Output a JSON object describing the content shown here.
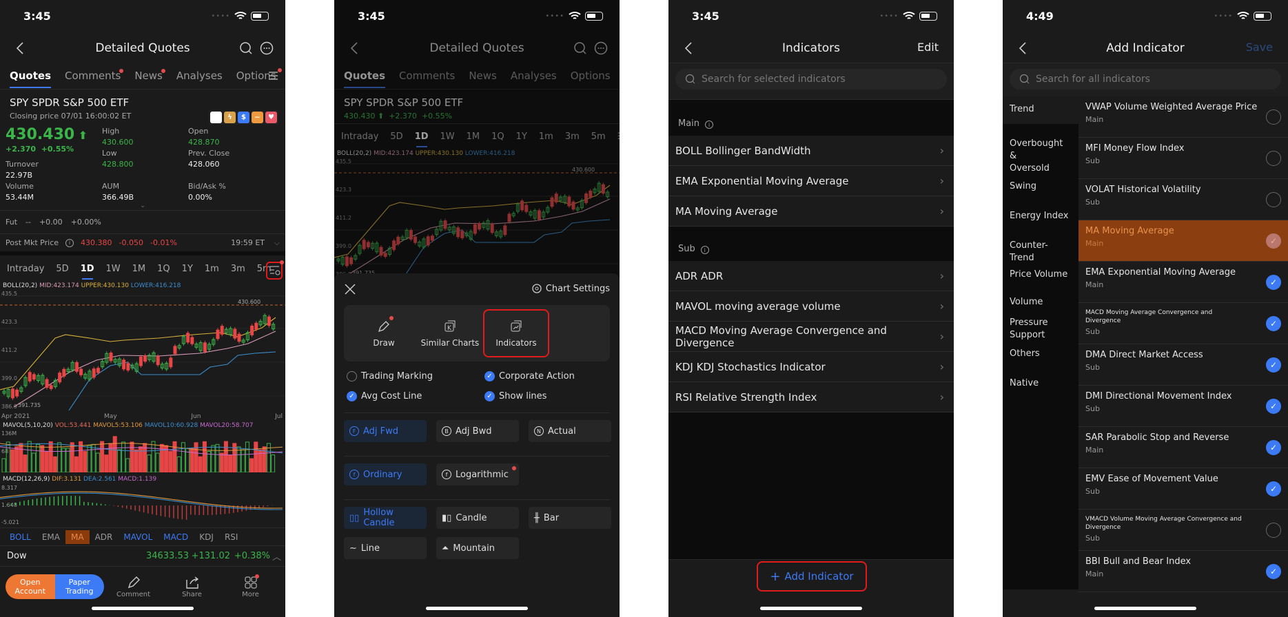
{
  "screen1": {
    "status_time": "3:45",
    "title": "Detailed Quotes",
    "tabs": [
      {
        "label": "Quotes",
        "active": true,
        "dot": false
      },
      {
        "label": "Comments",
        "active": false,
        "dot": true
      },
      {
        "label": "News",
        "active": false,
        "dot": true
      },
      {
        "label": "Analyses",
        "active": false,
        "dot": false
      },
      {
        "label": "Options",
        "active": false,
        "dot": false
      }
    ],
    "symbol_line": "SPY  SPDR S&P 500 ETF",
    "closing": "Closing price 07/01 16:00:02 ET",
    "price": "430.430",
    "change": "+2.370",
    "change_pct": "+0.55%",
    "stats": {
      "high_label": "High",
      "high": "430.600",
      "open_label": "Open",
      "open": "428.870",
      "turnover_label": "Turnover",
      "turnover": "22.97B",
      "low_label": "Low",
      "low": "428.800",
      "prev_close_label": "Prev. Close",
      "prev_close": "428.060",
      "volume_label": "Volume",
      "volume": "53.44M",
      "aum_label": "AUM",
      "aum": "366.49B",
      "bidask_label": "Bid/Ask %",
      "bidask": "0.00%"
    },
    "fut": {
      "label": "Fut",
      "value": "--",
      "change": "+0.00",
      "pct": "+0.00%"
    },
    "post": {
      "label": "Post Mkt Price",
      "price": "430.380",
      "change": "-0.050",
      "pct": "-0.01%",
      "time": "19:59 ET"
    },
    "periods": [
      "Intraday",
      "5D",
      "1D",
      "1W",
      "1M",
      "1Q",
      "1Y",
      "1m",
      "3m",
      "5m"
    ],
    "active_period": "1D",
    "boll_legend": {
      "name": "BOLL(20,2)",
      "mid": "MID:423.174",
      "upper": "UPPER:430.130",
      "lower": "LOWER:416.218"
    },
    "price_axis": [
      "435.5",
      "423.3",
      "411.2",
      "399.0",
      "386.9"
    ],
    "high_marker": "430.600",
    "low_marker": "391.735",
    "date_axis": [
      "Apr 2021",
      "May",
      "Jun",
      "Jul"
    ],
    "mavol_legend": {
      "name": "MAVOL(5,10,20)",
      "vol": "VOL:53.441",
      "m5": "MAVOL5:53.106",
      "m10": "MAVOL10:60.928",
      "m20": "MAVOL20:58.707"
    },
    "vol_axis": [
      "136M",
      "68"
    ],
    "macd_legend": {
      "name": "MACD(12,26,9)",
      "dif": "DIF:3.131",
      "dea": "DEA:2.561",
      "macd": "MACD:1.139"
    },
    "macd_axis": [
      "8.317",
      "1.648",
      "-5.021"
    ],
    "indicator_tabs": [
      {
        "label": "BOLL",
        "state": "on"
      },
      {
        "label": "EMA",
        "state": "off"
      },
      {
        "label": "MA",
        "state": "hl"
      },
      {
        "label": "ADR",
        "state": "off"
      },
      {
        "label": "MAVOL",
        "state": "on"
      },
      {
        "label": "MACD",
        "state": "on"
      },
      {
        "label": "KDJ",
        "state": "off"
      },
      {
        "label": "RSI",
        "state": "off"
      }
    ],
    "index": {
      "name": "Dow",
      "value": "34633.53",
      "change": "+131.02",
      "pct": "+0.38%"
    },
    "footer": {
      "open_account": "Open Account",
      "paper_trading": "Paper Trading",
      "comment": "Comment",
      "share": "Share",
      "more": "More"
    }
  },
  "screen2": {
    "status_time": "3:45",
    "title": "Detailed Quotes",
    "symbol_line": "SPY  SPDR S&P 500 ETF",
    "price_line": {
      "price": "430.430",
      "change": "+2.370",
      "pct": "+0.55%"
    },
    "chart_settings": "Chart Settings",
    "tools": [
      {
        "label": "Draw",
        "icon": "pencil-icon",
        "selected": false,
        "dot": true
      },
      {
        "label": "Similar Charts",
        "icon": "similar-charts-icon",
        "selected": false,
        "dot": false
      },
      {
        "label": "Indicators",
        "icon": "indicators-icon",
        "selected": true,
        "dot": false
      }
    ],
    "options": [
      {
        "label": "Trading Marking",
        "checked": false
      },
      {
        "label": "Corporate Action",
        "checked": true
      },
      {
        "label": "Avg Cost Line",
        "checked": true
      },
      {
        "label": "Show lines",
        "checked": true
      }
    ],
    "adjust": [
      {
        "label": "Adj Fwd",
        "icon": "F",
        "active": true
      },
      {
        "label": "Adj Bwd",
        "icon": "B",
        "active": false
      },
      {
        "label": "Actual",
        "icon": "N",
        "active": false
      }
    ],
    "scale": [
      {
        "label": "Ordinary",
        "icon": "f1",
        "active": true
      },
      {
        "label": "Logarithmic",
        "icon": "f2",
        "active": false,
        "dot": true
      }
    ],
    "chart_types": [
      {
        "label": "Hollow Candle",
        "active": true
      },
      {
        "label": "Candle",
        "active": false
      },
      {
        "label": "Bar",
        "active": false
      },
      {
        "label": "Line",
        "active": false
      },
      {
        "label": "Mountain",
        "active": false
      }
    ]
  },
  "screen3": {
    "status_time": "3:45",
    "title": "Indicators",
    "edit": "Edit",
    "search_placeholder": "Search for selected indicators",
    "main_label": "Main",
    "main_items": [
      "BOLL Bollinger BandWidth",
      "EMA Exponential Moving Average",
      "MA Moving Average"
    ],
    "sub_label": "Sub",
    "sub_items": [
      "ADR ADR",
      "MAVOL moving average volume",
      "MACD Moving Average Convergence and Divergence",
      "KDJ KDJ Stochastics Indicator",
      "RSI Relative Strength Index"
    ],
    "add_button": "Add Indicator"
  },
  "screen4": {
    "status_time": "4:49",
    "title": "Add Indicator",
    "save": "Save",
    "search_placeholder": "Search for all indicators",
    "categories": [
      "Trend",
      "Overbought & Oversold",
      "Swing",
      "Energy Index",
      "Counter-Trend",
      "Price Volume",
      "Volume",
      "Pressure Support",
      "Others",
      "Native"
    ],
    "indicators": [
      {
        "name": "VWAP Volume Weighted Average Price",
        "type": "Main",
        "checked": false,
        "highlight": false,
        "small": false
      },
      {
        "name": "MFI Money Flow Index",
        "type": "Sub",
        "checked": false,
        "highlight": false,
        "small": false
      },
      {
        "name": "VOLAT Historical Volatility",
        "type": "Sub",
        "checked": false,
        "highlight": false,
        "small": false
      },
      {
        "name": "MA Moving Average",
        "type": "Main",
        "checked": true,
        "highlight": true,
        "small": false
      },
      {
        "name": "EMA Exponential Moving Average",
        "type": "Main",
        "checked": true,
        "highlight": false,
        "small": false
      },
      {
        "name": "MACD Moving Average Convergence and Divergence",
        "type": "Sub",
        "checked": true,
        "highlight": false,
        "small": true
      },
      {
        "name": "DMA Direct Market Access",
        "type": "Sub",
        "checked": true,
        "highlight": false,
        "small": false
      },
      {
        "name": "DMI Directional Movement Index",
        "type": "Sub",
        "checked": true,
        "highlight": false,
        "small": false
      },
      {
        "name": "SAR Parabolic Stop and Reverse",
        "type": "Main",
        "checked": true,
        "highlight": false,
        "small": false
      },
      {
        "name": "EMV Ease of Movement Value",
        "type": "Sub",
        "checked": true,
        "highlight": false,
        "small": false
      },
      {
        "name": "VMACD Volume Moving Average Convergence and Divergence",
        "type": "Sub",
        "checked": false,
        "highlight": false,
        "small": true
      },
      {
        "name": "BBI Bull and Bear Index",
        "type": "Main",
        "checked": true,
        "highlight": false,
        "small": false
      }
    ]
  },
  "colors": {
    "accent": "#3d7af5",
    "up": "#3bb54a",
    "down": "#e84646",
    "highlight": "#8b3f10",
    "selection_border": "#e01b1b",
    "open_account": "#ee7733",
    "paper_trading": "#3d7af5"
  }
}
